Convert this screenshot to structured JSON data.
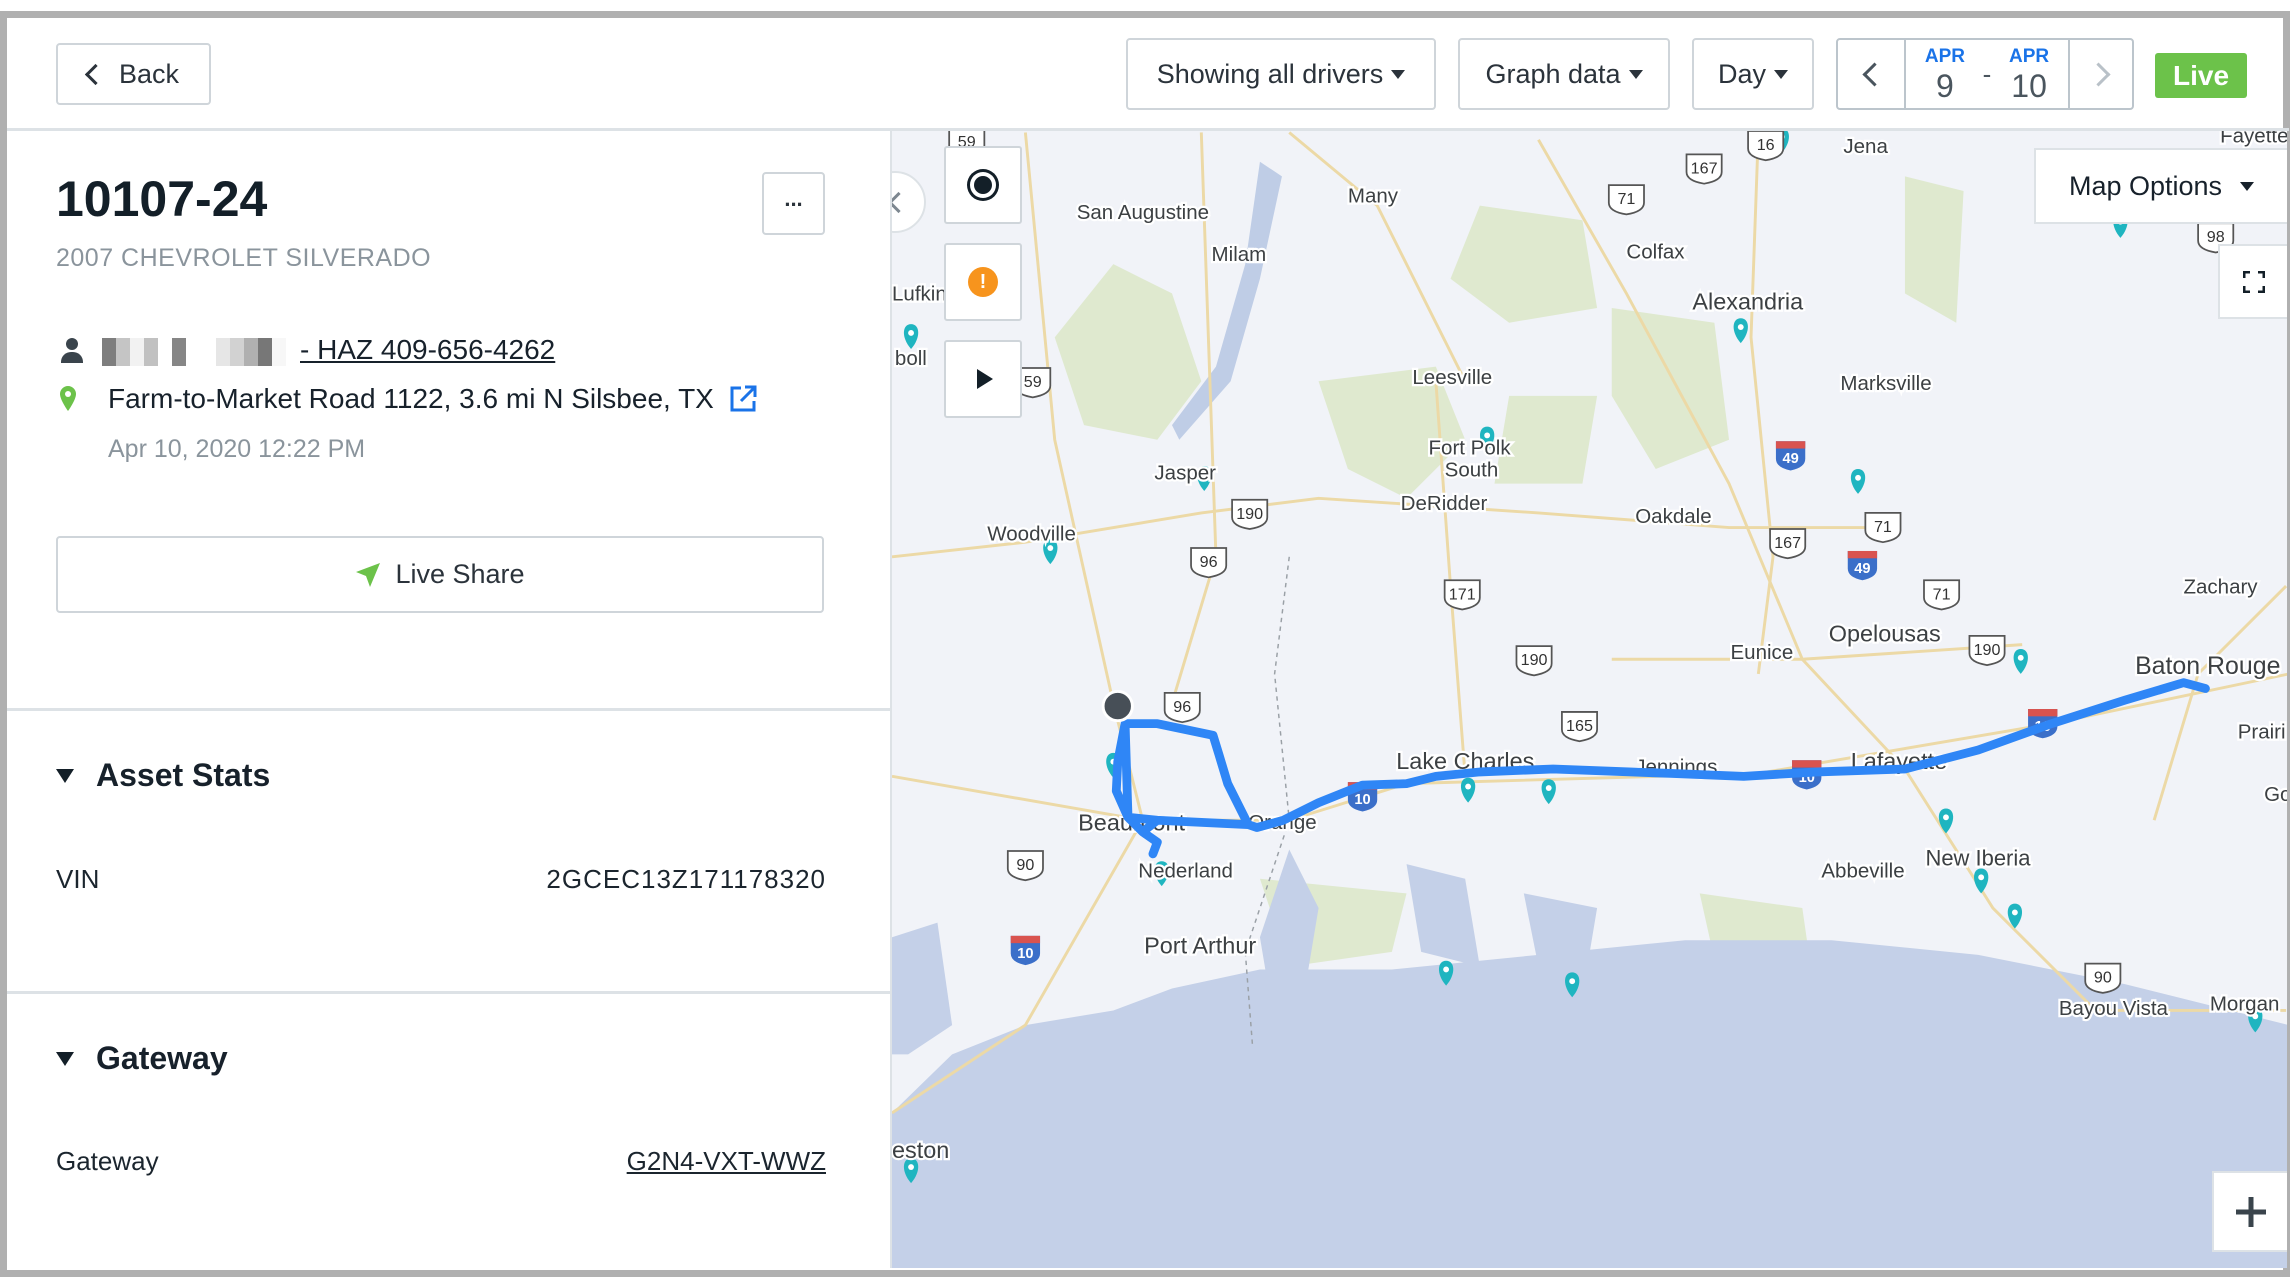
{
  "header": {
    "back_label": "Back",
    "drivers_filter": "Showing all drivers",
    "graph_data": "Graph data",
    "range": "Day",
    "date_start": {
      "month": "APR",
      "day": "9"
    },
    "date_sep": "-",
    "date_end": {
      "month": "APR",
      "day": "10"
    },
    "live_label": "Live"
  },
  "vehicle": {
    "name": "10107-24",
    "model": "2007 CHEVROLET SILVERADO",
    "driver_suffix": "- HAZ 409-656-4262",
    "location": "Farm-to-Market Road 1122, 3.6 mi N Silsbee, TX",
    "timestamp": "Apr 10, 2020 12:22 PM",
    "more_label": "...",
    "live_share_label": "Live Share"
  },
  "asset_stats": {
    "title": "Asset Stats",
    "rows": [
      {
        "label": "VIN",
        "value": "2GCEC13Z171178320"
      }
    ]
  },
  "gateway": {
    "title": "Gateway",
    "rows": [
      {
        "label": "Gateway",
        "value": "G2N4-VXT-WWZ"
      }
    ]
  },
  "map": {
    "options_label": "Map Options",
    "labels": [
      "San Augustine",
      "Many",
      "Milam",
      "Colfax",
      "Alexandria",
      "Jena",
      "Lufkin",
      "Leesville",
      "Marksville",
      "Fort Polk",
      "South",
      "DeRidder",
      "Jasper",
      "Woodville",
      "Oakdale",
      "Eunice",
      "Opelousas",
      "Zachary",
      "Baton Rouge",
      "Lake Charles",
      "Jennings",
      "Lafayette",
      "Beaumont",
      "Orange",
      "Nederland",
      "Abbeville",
      "New Iberia",
      "Port Arthur",
      "Bayou Vista",
      "Morgan",
      "Prairi",
      "eston",
      "Fayette",
      "Go",
      "boll"
    ],
    "us_routes": [
      "59",
      "167",
      "71",
      "16",
      "59",
      "190",
      "96",
      "171",
      "167",
      "71",
      "71",
      "190",
      "190",
      "96",
      "165",
      "90",
      "90",
      "98"
    ],
    "interstates": [
      "49",
      "49",
      "10",
      "10",
      "10",
      "10"
    ],
    "colors": {
      "route": "#2f86f6",
      "poi": "#1fb5c0",
      "live": "#6cc24a",
      "accent": "#1a73e8"
    }
  },
  "icons": [
    "chevron-left-icon",
    "person-icon",
    "map-pin-icon",
    "external-link-icon",
    "send-icon",
    "record-icon",
    "alert-icon",
    "play-icon",
    "fullscreen-icon",
    "plus-icon"
  ]
}
